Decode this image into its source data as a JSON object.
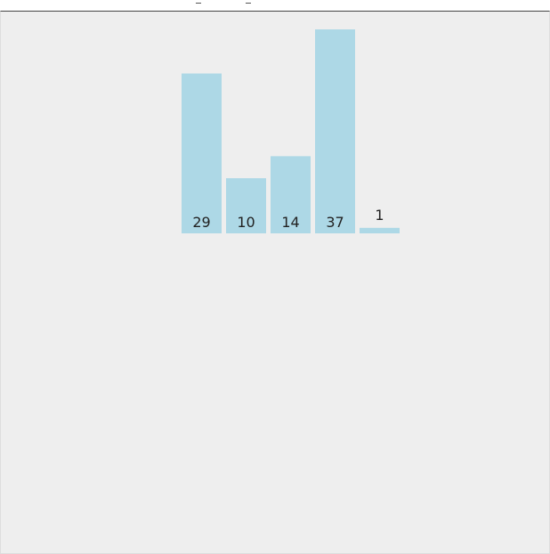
{
  "chart_data": {
    "type": "bar",
    "categories": [
      "",
      "",
      "",
      "",
      ""
    ],
    "values": [
      29,
      10,
      14,
      37,
      1
    ],
    "data_labels": [
      "29",
      "10",
      "14",
      "37",
      "1"
    ],
    "title": "",
    "xlabel": "",
    "ylabel": "",
    "ylim": [
      0,
      37
    ],
    "grid": false,
    "legend": "none",
    "colors": {
      "bar": "#add8e6",
      "label": "#222222",
      "background": "#eeeeee"
    }
  }
}
